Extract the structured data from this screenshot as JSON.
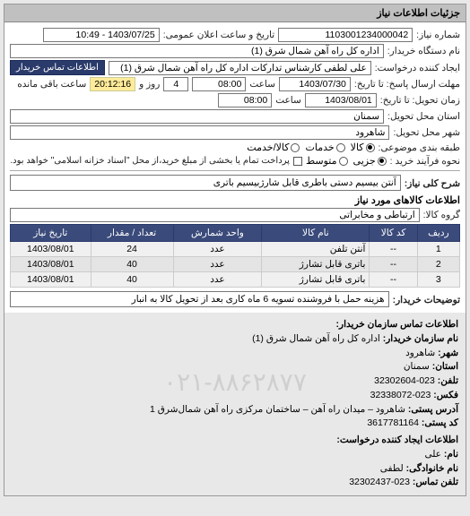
{
  "header": {
    "title": "جزئیات اطلاعات نیاز"
  },
  "fields": {
    "number_lbl": "شماره نیاز:",
    "number_val": "1103001234000042",
    "notice_date_lbl": "تاریخ و ساعت اعلان عمومی:",
    "notice_date_val": "1403/07/25 - 10:49",
    "buyer_org_lbl": "نام دستگاه خریدار:",
    "buyer_org_val": "اداره کل راه آهن شمال شرق (1)",
    "requester_lbl": "ایجاد کننده درخواست:",
    "requester_val": "علی لطفی کارشناس تدارکات اداره کل راه آهن شمال شرق (1)",
    "contact_btn": "اطلاعات تماس خریدار",
    "resp_deadline_lbl": "مهلت ارسال پاسخ: تا تاریخ:",
    "resp_date": "1403/07/30",
    "resp_time": "08:00",
    "clock_lbl": "ساعت",
    "days_remain": "4",
    "days_lbl": "روز و",
    "timer": "20:12:16",
    "timer_lbl": "ساعت باقی مانده",
    "valid_lbl": "زمان تحویل: تا تاریخ:",
    "valid_date": "1403/08/01",
    "valid_time": "08:00",
    "deliv_prov_lbl": "استان محل تحویل:",
    "deliv_prov_val": "سمنان",
    "deliv_city_lbl": "شهر محل تحویل:",
    "deliv_city_val": "شاهرود",
    "subject_cat_lbl": "طبقه بندی موضوعی:",
    "r_kala": "کالا",
    "r_khadamat": "خدمات",
    "r_both": "کالا/خدمت",
    "buy_type_lbl": "نحوه فرآیند خرید :",
    "r_jozi": "جزیی",
    "r_motavaset": "متوسط",
    "buy_note": "پرداخت تمام یا بخشی از مبلغ خرید،از محل \"اسناد خزانه اسلامی\" خواهد بود.",
    "overview_lbl": "شرح کلی نیاز:",
    "overview_val": "آنتن بیسیم دستی باطری قابل شارژبیسیم باتری",
    "goods_header": "اطلاعات کالاهای مورد نیاز",
    "group_lbl": "گروه کالا:",
    "group_val": "ارتباطی و مخابراتی",
    "buyer_desc_lbl": "توضیحات خریدار:",
    "buyer_desc_val": "هزینه حمل با فروشنده تسویه 6 ماه کاری بعد از تحویل کالا به انبار"
  },
  "table": {
    "cols": [
      "ردیف",
      "کد کالا",
      "نام کالا",
      "واحد شمارش",
      "تعداد / مقدار",
      "تاریخ نیاز"
    ],
    "rows": [
      {
        "n": "1",
        "code": "--",
        "name": "آنتن تلفن",
        "unit": "عدد",
        "qty": "24",
        "date": "1403/08/01"
      },
      {
        "n": "2",
        "code": "--",
        "name": "باتری قابل تشارژ",
        "unit": "عدد",
        "qty": "40",
        "date": "1403/08/01"
      },
      {
        "n": "3",
        "code": "--",
        "name": "باتری قابل تشارژ",
        "unit": "عدد",
        "qty": "40",
        "date": "1403/08/01"
      }
    ]
  },
  "contact": {
    "header": "اطلاعات تماس سازمان خریدار:",
    "org_lbl": "نام سازمان خریدار:",
    "org_val": "اداره کل راه آهن شمال شرق (1)",
    "city_lbl": "شهر:",
    "city_val": "شاهرود",
    "prov_lbl": "استان:",
    "prov_val": "سمنان",
    "phone_lbl": "تلفن:",
    "phone_val": "023-32302604",
    "fax_lbl": "فکس:",
    "fax_val": "023-32338072",
    "addr_lbl": "آدرس پستی:",
    "addr_val": "شاهرود – میدان راه آهن – ساختمان مرکزی راه آهن شمال‌شرق 1",
    "zip_lbl": "کد پستی:",
    "zip_val": "3617781164",
    "creator_header": "اطلاعات ایجاد کننده درخواست:",
    "fname_lbl": "نام:",
    "fname_val": "علی",
    "lname_lbl": "نام خانوادگی:",
    "lname_val": "لطفی",
    "cphone_lbl": "تلفن تماس:",
    "cphone_val": "023-32302437"
  },
  "watermark": "۰۲۱-۸۸۶۲۸۷۷"
}
